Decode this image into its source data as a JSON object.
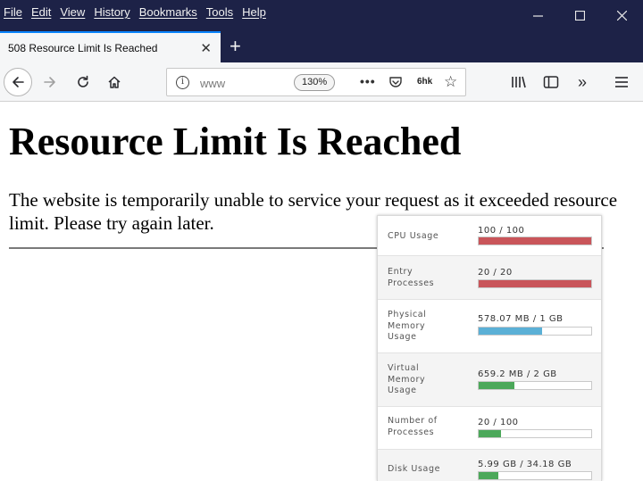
{
  "menu": [
    "File",
    "Edit",
    "View",
    "History",
    "Bookmarks",
    "Tools",
    "Help"
  ],
  "tab": {
    "title": "508 Resource Limit Is Reached",
    "close": "✕",
    "new": "+"
  },
  "navbar": {
    "url": "www",
    "zoom": "130%",
    "ellipsis": "•••",
    "extension_label": "6hk",
    "star": "☆",
    "overflow": "»"
  },
  "page": {
    "heading": "Resource Limit Is Reached",
    "message": "The website is temporarily unable to service your request as it exceeded resource limit. Please try again later."
  },
  "resources": [
    {
      "label": "CPU Usage",
      "value": "100 / 100",
      "fill": 1.0,
      "color": "#c9555a"
    },
    {
      "label": "Entry\nProcesses",
      "value": "20 / 20",
      "fill": 1.0,
      "color": "#c9555a"
    },
    {
      "label": "Physical\nMemory\nUsage",
      "value": "578.07 MB / 1 GB",
      "fill": 0.565,
      "color": "#5bb0d6"
    },
    {
      "label": "Virtual\nMemory\nUsage",
      "value": "659.2 MB / 2 GB",
      "fill": 0.32,
      "color": "#4ca85a"
    },
    {
      "label": "Number of\nProcesses",
      "value": "20 / 100",
      "fill": 0.2,
      "color": "#4ca85a"
    },
    {
      "label": "Disk Usage",
      "value": "5.99 GB / 34.18 GB",
      "fill": 0.175,
      "color": "#4ca85a"
    }
  ],
  "colors": {
    "chrome_dark": "#1d2247",
    "tab_accent": "#0a84ff"
  }
}
